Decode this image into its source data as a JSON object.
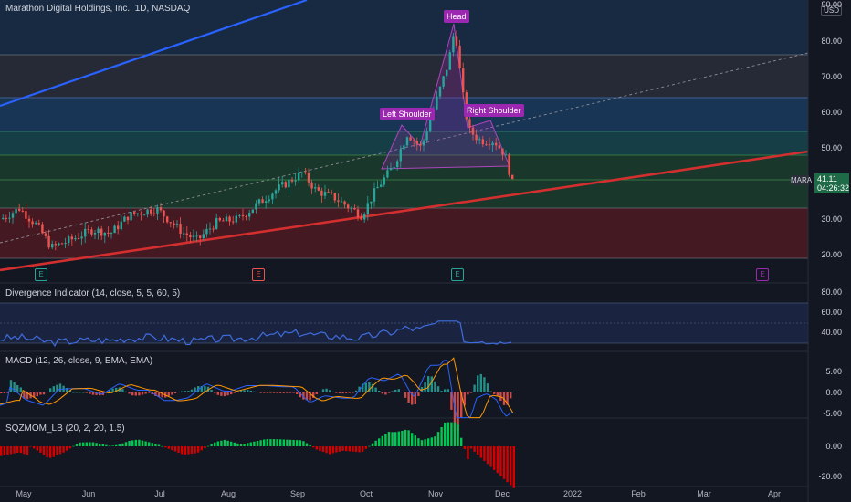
{
  "header": {
    "title": "Marathon Digital Holdings, Inc., 1D, NASDAQ",
    "currency": "USD"
  },
  "price_axis": [
    "90.00",
    "80.00",
    "70.00",
    "60.00",
    "50.00",
    "40.00",
    "30.00",
    "20.00"
  ],
  "last_price": {
    "symbol": "MARA",
    "value": "41.11",
    "countdown": "04:26:32"
  },
  "pattern_labels": {
    "head": "Head",
    "left": "Left Shoulder",
    "right": "Right Shoulder"
  },
  "event_marks": [
    {
      "glyph": "E",
      "color": "#26a69a"
    },
    {
      "glyph": "E",
      "color": "#ef5350"
    },
    {
      "glyph": "E",
      "color": "#26a69a"
    },
    {
      "glyph": "E",
      "color": "#9c27b0"
    }
  ],
  "panes": {
    "divergence": {
      "label": "Divergence Indicator (14, close, 5, 5, 60, 5)",
      "ticks": [
        "80.00",
        "60.00",
        "40.00"
      ]
    },
    "macd": {
      "label": "MACD (12, 26, close, 9, EMA, EMA)",
      "ticks": [
        "5.00",
        "0.00",
        "-5.00"
      ]
    },
    "sqz": {
      "label": "SQZMOM_LB (20, 2, 20, 1.5)",
      "ticks": [
        "0.00",
        "-20.00"
      ]
    }
  },
  "time_axis": [
    "May",
    "Jun",
    "Jul",
    "Aug",
    "Sep",
    "Oct",
    "Nov",
    "Dec",
    "2022",
    "Feb",
    "Mar",
    "Apr"
  ],
  "colors": {
    "bg": "#131722",
    "up": "#26a69a",
    "down": "#ef5350",
    "trend": "#d32f2f",
    "blue_line": "#2962ff",
    "purple": "#9c27b0"
  },
  "chart_data": {
    "type": "candlestick",
    "title": "Marathon Digital Holdings, Inc., 1D, NASDAQ",
    "ylim": [
      16,
      92
    ],
    "approx_close_path": [
      [
        "May",
        22
      ],
      [
        "Jun",
        23
      ],
      [
        "Jul",
        30
      ],
      [
        "Aug",
        30
      ],
      [
        "Sep",
        40
      ],
      [
        "Oct",
        32
      ],
      [
        "Oct",
        48
      ],
      [
        "Nov",
        84
      ],
      [
        "Nov",
        52
      ],
      [
        "Dec",
        41.11
      ]
    ]
  }
}
